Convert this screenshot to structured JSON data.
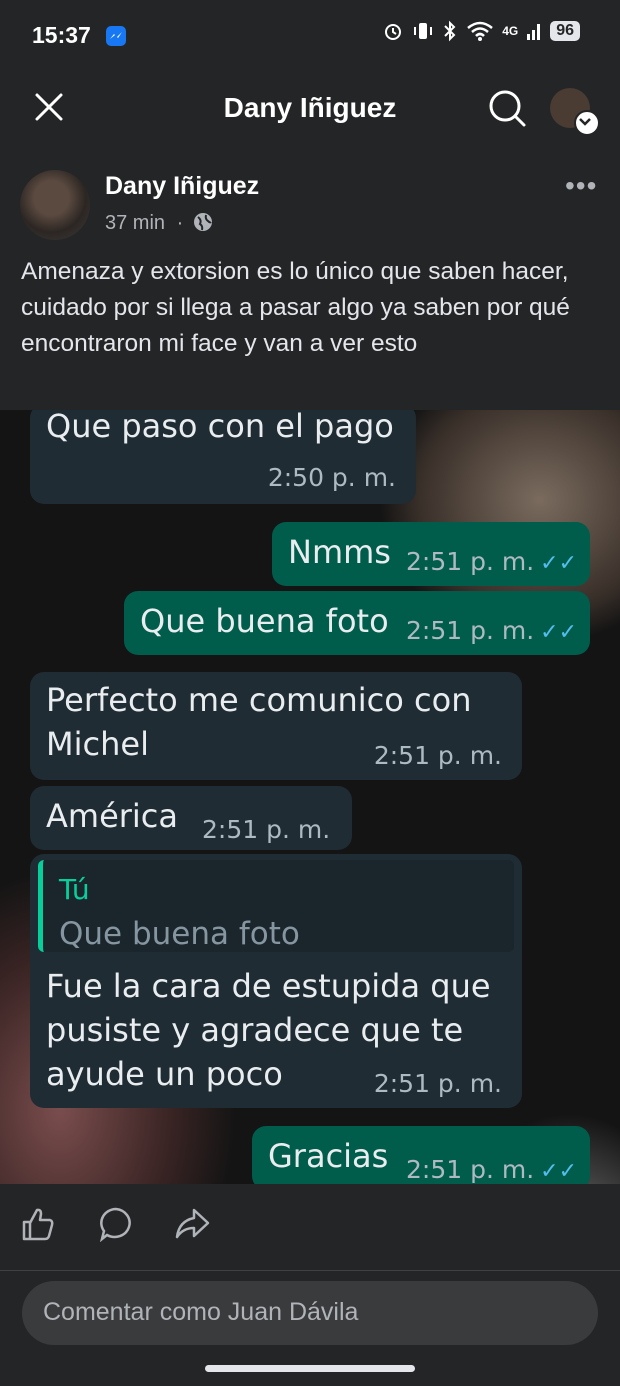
{
  "status_bar": {
    "time": "15:37",
    "network": "4G",
    "battery": "96"
  },
  "nav": {
    "title": "Dany Iñiguez"
  },
  "post": {
    "author": "Dany Iñiguez",
    "time": "37 min",
    "separator": "·",
    "more": "•••",
    "text": "Amenaza y extorsion es lo único que saben hacer, cuidado por si llega a pasar algo ya saben por qué encontraron mi face y van a ver esto"
  },
  "chat": {
    "messages": [
      {
        "dir": "in",
        "text": "Que paso con el pago",
        "time": "2:50 p. m."
      },
      {
        "dir": "out",
        "text": "Nmms",
        "time": "2:51 p. m.",
        "ticks": "✓✓"
      },
      {
        "dir": "out",
        "text": "Que buena foto",
        "time": "2:51 p. m.",
        "ticks": "✓✓"
      },
      {
        "dir": "in",
        "text": "Perfecto me comunico con Michel",
        "time": "2:51 p. m."
      },
      {
        "dir": "in",
        "text": "América",
        "time": "2:51 p. m."
      },
      {
        "dir": "in",
        "reply_author": "Tú",
        "reply_text": "Que buena foto",
        "text": "Fue la cara de estupida que pusiste y agradece que te ayude un poco",
        "time": "2:51 p. m."
      },
      {
        "dir": "out",
        "text": "Gracias",
        "time": "2:51 p. m.",
        "ticks": "✓✓"
      }
    ]
  },
  "comment": {
    "placeholder": "Comentar como Juan Dávila"
  },
  "icons": [
    "close-icon",
    "search-icon",
    "globe-icon",
    "like-icon",
    "comment-icon",
    "share-icon"
  ]
}
